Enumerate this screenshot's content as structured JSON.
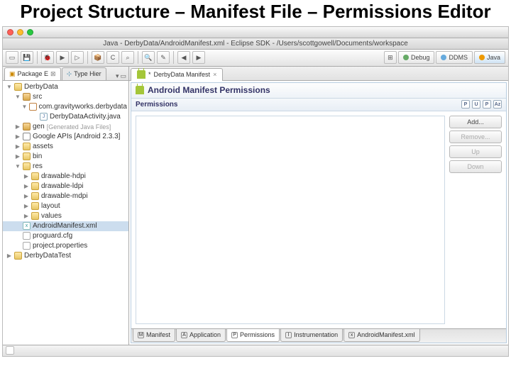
{
  "slide_title": "Project Structure – Manifest File – Permissions Editor",
  "window_title": "Java - DerbyData/AndroidManifest.xml - Eclipse SDK - /Users/scottgowell/Documents/workspace",
  "perspectives": [
    {
      "label": "Debug",
      "icon": "bug",
      "color": "#6a6"
    },
    {
      "label": "DDMS",
      "icon": "ddms",
      "color": "#6ad"
    },
    {
      "label": "Java",
      "icon": "java",
      "color": "#e90",
      "active": true
    }
  ],
  "left_tabs": [
    {
      "label": "Package E",
      "active": true
    },
    {
      "label": "Type Hier",
      "active": false
    }
  ],
  "project_tree": [
    {
      "indent": 0,
      "tw": "▼",
      "ico": "proj",
      "label": "DerbyData"
    },
    {
      "indent": 1,
      "tw": "▼",
      "ico": "pkg-root",
      "label": "src"
    },
    {
      "indent": 2,
      "tw": "▼",
      "ico": "pkg",
      "label": "com.gravityworks.derbydata"
    },
    {
      "indent": 3,
      "tw": "",
      "ico": "java",
      "label": "DerbyDataActivity.java"
    },
    {
      "indent": 1,
      "tw": "▶",
      "ico": "pkg-root",
      "label": "gen",
      "decor": "[Generated Java Files]"
    },
    {
      "indent": 1,
      "tw": "▶",
      "ico": "lib",
      "label": "Google APIs [Android 2.3.3]"
    },
    {
      "indent": 1,
      "tw": "▶",
      "ico": "folder",
      "label": "assets"
    },
    {
      "indent": 1,
      "tw": "▶",
      "ico": "folder",
      "label": "bin"
    },
    {
      "indent": 1,
      "tw": "▼",
      "ico": "folder",
      "label": "res"
    },
    {
      "indent": 2,
      "tw": "▶",
      "ico": "folder",
      "label": "drawable-hdpi"
    },
    {
      "indent": 2,
      "tw": "▶",
      "ico": "folder",
      "label": "drawable-ldpi"
    },
    {
      "indent": 2,
      "tw": "▶",
      "ico": "folder",
      "label": "drawable-mdpi"
    },
    {
      "indent": 2,
      "tw": "▶",
      "ico": "folder",
      "label": "layout"
    },
    {
      "indent": 2,
      "tw": "▶",
      "ico": "folder",
      "label": "values"
    },
    {
      "indent": 1,
      "tw": "",
      "ico": "xml",
      "label": "AndroidManifest.xml",
      "selected": true
    },
    {
      "indent": 1,
      "tw": "",
      "ico": "txt",
      "label": "proguard.cfg"
    },
    {
      "indent": 1,
      "tw": "",
      "ico": "txt",
      "label": "project.properties"
    },
    {
      "indent": 0,
      "tw": "▶",
      "ico": "proj",
      "label": "DerbyDataTest"
    }
  ],
  "editor_tab": {
    "dirty": "*",
    "label": "DerbyData Manifest"
  },
  "form_title": "Android Manifest Permissions",
  "section_label": "Permissions",
  "section_icons": [
    "P",
    "U",
    "P",
    "Az"
  ],
  "perm_buttons": {
    "add": "Add...",
    "remove": "Remove...",
    "up": "Up",
    "down": "Down"
  },
  "bottom_tabs": [
    {
      "ico": "M",
      "label": "Manifest"
    },
    {
      "ico": "A",
      "label": "Application"
    },
    {
      "ico": "P",
      "label": "Permissions",
      "active": true
    },
    {
      "ico": "I",
      "label": "Instrumentation"
    },
    {
      "ico": "x",
      "label": "AndroidManifest.xml"
    }
  ]
}
